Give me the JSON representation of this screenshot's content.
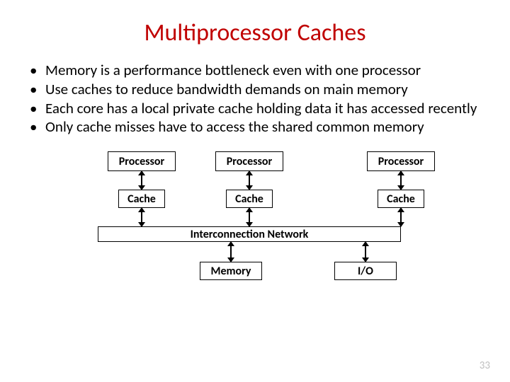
{
  "title": "Multiprocessor Caches",
  "bullets": [
    "Memory is a performance bottleneck even with one processor",
    "Use caches to reduce bandwidth demands on main memory",
    "Each core has a local private cache holding data it has accessed recently",
    "Only cache misses have to access the shared common memory"
  ],
  "diagram": {
    "processor": "Processor",
    "cache": "Cache",
    "interconnect": "Interconnection Network",
    "memory": "Memory",
    "io": "I/O"
  },
  "page_number": "33"
}
